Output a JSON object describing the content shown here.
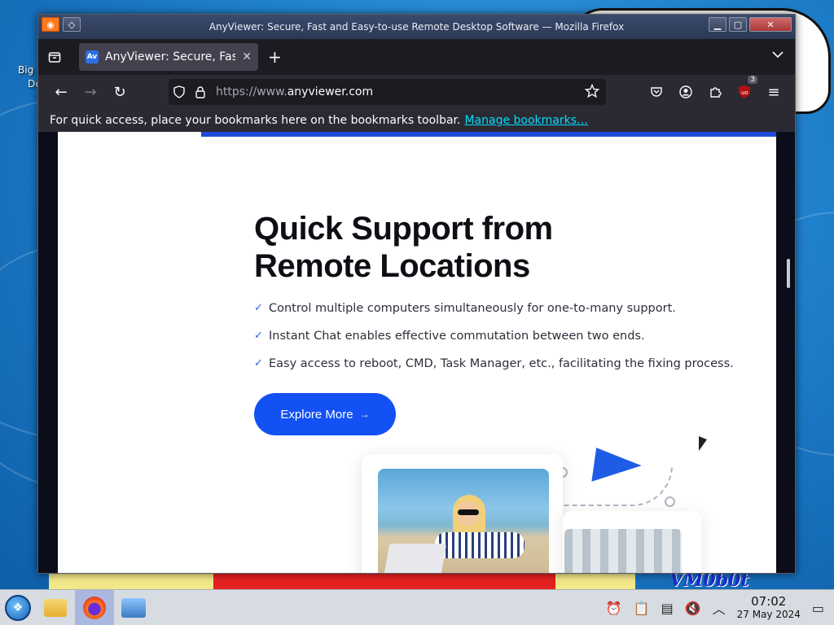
{
  "window": {
    "title": "AnyViewer: Secure, Fast and Easy-to-use Remote Desktop Software — Mozilla Firefox"
  },
  "tabs": [
    {
      "title": "AnyViewer: Secure, Fast",
      "favicon": "Av"
    }
  ],
  "url": {
    "prefix": "https://www.",
    "domain": "anyviewer.com"
  },
  "bookmarks": {
    "message": "For quick access, place your bookmarks here on the bookmarks toolbar.",
    "link": "Manage bookmarks…"
  },
  "extensions_badge": "3",
  "page": {
    "heading": "Quick Support from Remote Locations",
    "features": [
      "Control multiple computers simultaneously for one-to-many support.",
      "Instant Chat enables effective commutation between two ends.",
      "Easy access to reboot, CMD, Task Manager, etc., facilitating the fixing process."
    ],
    "cta_label": "Explore More",
    "accent_color": "#1351f5"
  },
  "desktop": {
    "icon_label_line1": "Big",
    "icon_label_line2": "De",
    "watermark": "VM0b0t"
  },
  "taskbar": {
    "time": "07:02",
    "date": "27 May 2024"
  }
}
